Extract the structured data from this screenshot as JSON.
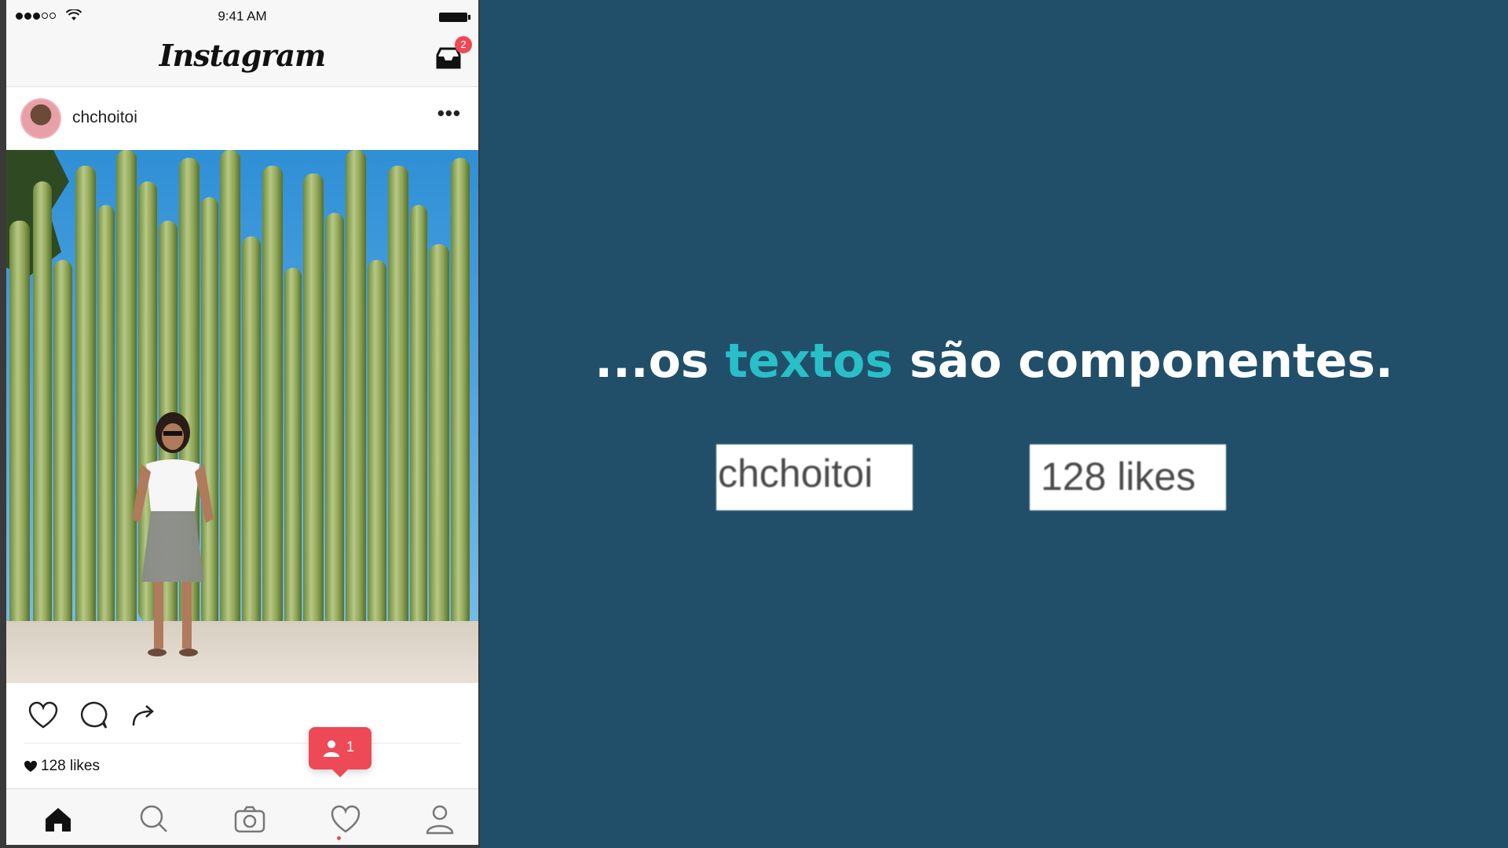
{
  "status_bar": {
    "time": "9:41 AM"
  },
  "app": {
    "logo_text": "Instagram",
    "inbox_badge_count": "2"
  },
  "post": {
    "username": "chchoitoi",
    "more_label": "•••",
    "likes": "128 likes"
  },
  "notification": {
    "count": "1"
  },
  "tabs": [
    "home-icon",
    "search-icon",
    "camera-icon",
    "heart-icon",
    "profile-icon"
  ],
  "slide": {
    "headline_prefix": "...os ",
    "headline_accent": "textos",
    "headline_suffix": " são componentes.",
    "chip_username": "chchoitoi",
    "chip_likes": "128 likes"
  },
  "colors": {
    "background": "#214f69",
    "accent": "#29bfc9",
    "notification_red": "#ed4956"
  }
}
